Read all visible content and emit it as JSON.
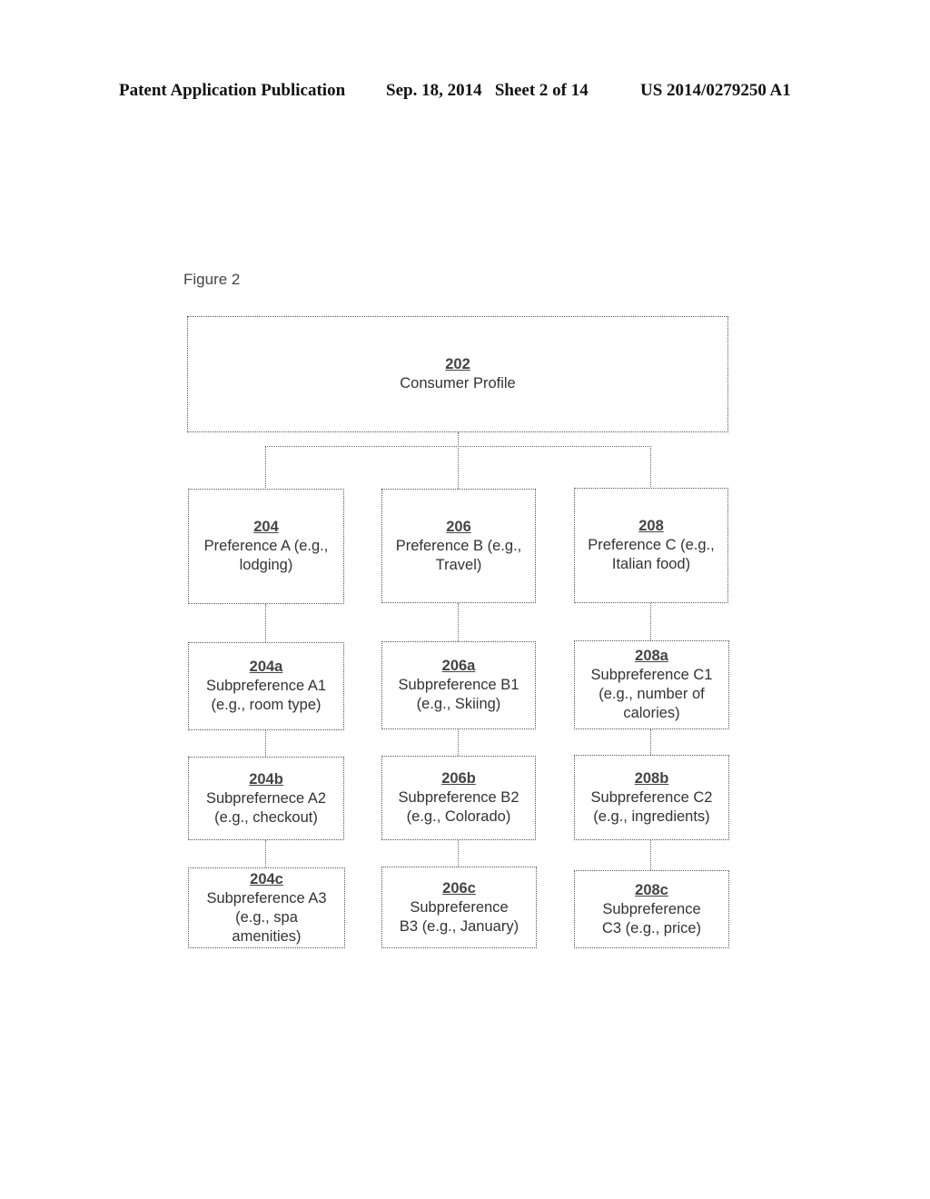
{
  "header": {
    "publication": "Patent Application Publication",
    "date_sheet": "Sep. 18, 2014   Sheet 2 of 14",
    "number": "US 2014/0279250 A1"
  },
  "figure": {
    "label": "Figure 2",
    "root": {
      "ref": "202",
      "text": "Consumer Profile"
    },
    "columns": [
      {
        "preference": {
          "ref": "204",
          "text": "Preference A (e.g.,\nlodging)"
        },
        "subs": [
          {
            "ref": "204a",
            "text": "Subpreference A1\n(e.g., room type)"
          },
          {
            "ref": "204b",
            "text": "Subprefernece A2\n(e.g., checkout)"
          },
          {
            "ref": "204c",
            "text": "Subpreference A3\n(e.g., spa\namenities)"
          }
        ]
      },
      {
        "preference": {
          "ref": "206",
          "text": "Preference B (e.g.,\nTravel)"
        },
        "subs": [
          {
            "ref": "206a",
            "text": "Subpreference B1\n(e.g., Skiing)"
          },
          {
            "ref": "206b",
            "text": "Subpreference B2\n(e.g., Colorado)"
          },
          {
            "ref": "206c",
            "text": "Subpreference\nB3 (e.g., January)"
          }
        ]
      },
      {
        "preference": {
          "ref": "208",
          "text": "Preference C (e.g.,\nItalian food)"
        },
        "subs": [
          {
            "ref": "208a",
            "text": "Subpreference C1\n(e.g., number of\ncalories)"
          },
          {
            "ref": "208b",
            "text": "Subpreference C2\n(e.g., ingredients)"
          },
          {
            "ref": "208c",
            "text": "Subpreference\nC3 (e.g., price)"
          }
        ]
      }
    ]
  }
}
